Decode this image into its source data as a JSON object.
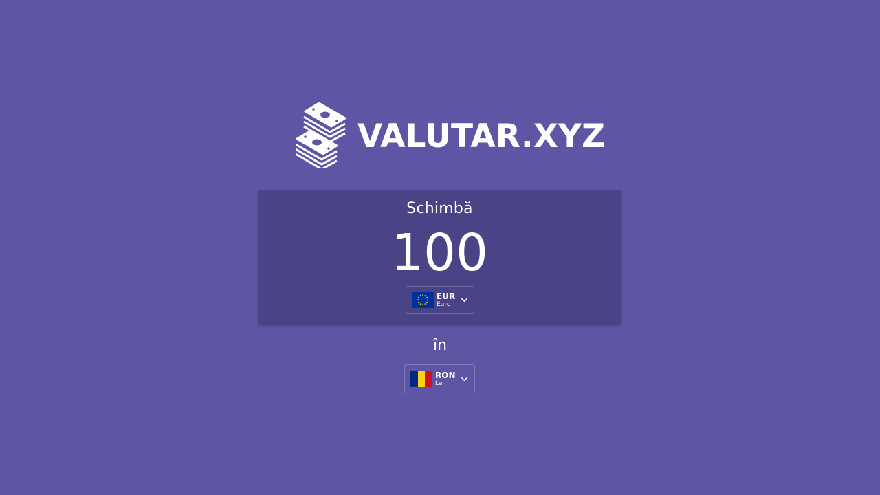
{
  "brand": {
    "name": "VALUTAR.XYZ",
    "icon": "money-stack-icon"
  },
  "converter": {
    "from_label": "Schimbă",
    "amount": "100",
    "from_currency": {
      "code": "EUR",
      "name": "Euro",
      "flag": "eu-flag-icon"
    },
    "to_label": "în",
    "to_currency": {
      "code": "RON",
      "name": "Lei",
      "flag": "romania-flag-icon"
    }
  },
  "colors": {
    "background": "#5d56a5",
    "card": "#4a4386",
    "text": "#ffffff",
    "eu_blue": "#003399",
    "eu_star": "#ffcc00",
    "ro_blue": "#002b7f",
    "ro_yellow": "#fcd116",
    "ro_red": "#ce1126"
  }
}
